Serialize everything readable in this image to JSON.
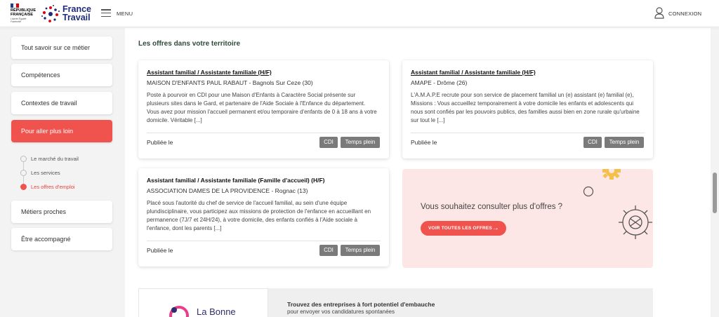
{
  "header": {
    "republic": "RÉPUBLIQUE FRANÇAISE",
    "motto": "Liberté Égalité Fraternité",
    "brand_line1": "France",
    "brand_line2": "Travail",
    "menu_label": "MENU",
    "login_label": "CONNEXION",
    "icons": [
      "marianne-logo",
      "france-travail-logo",
      "menu-icon",
      "user-icon"
    ]
  },
  "sidebar": {
    "items": [
      {
        "label": "Tout savoir sur ce métier"
      },
      {
        "label": "Compétences"
      },
      {
        "label": "Contextes de travail"
      },
      {
        "label": "Pour aller plus loin",
        "active": true
      },
      {
        "label": "Métiers proches"
      },
      {
        "label": "Être accompagné"
      }
    ],
    "subitems": [
      {
        "label": "Le marché du travail"
      },
      {
        "label": "Les services"
      },
      {
        "label": "Les offres d'emploi",
        "active": true
      }
    ]
  },
  "main": {
    "section_title": "Les offres dans votre territoire",
    "offers": [
      {
        "title": "Assistant familial / Assistante familiale (H/F)",
        "company": "MAISON D'ENFANTS PAUL RABAUT - Bagnols Sur Ceze (30)",
        "description": "Poste à pourvoir en CDI pour une Maison d'Enfants à Caractère Social présente sur plusieurs sites dans le Gard, et partenaire de l'Aide Sociale à l'Enfance du département. Vous avez pour mission l'accueil permanent et/ou temporaire d'enfants de 0 à 18 ans à votre domicile. Véritable [...]",
        "published": "Publiée le",
        "tags": [
          "CDI",
          "Temps plein"
        ]
      },
      {
        "title": "Assistant familial / Assistante familiale (H/F)",
        "company": "AMAPE - Drôme (26)",
        "description": "L'A.M.A.P.E recrute pour son service de placement familial un (e) assistant (e) familial (e), Missions : Vous accueillez temporairement à votre domicile les enfants et adolescents qui nous sont confiés par les pouvoirs publics, des familles aussi bien en zone rurale qu'urbaine sur tout le [...]",
        "published": "Publiée le",
        "tags": [
          "CDI",
          "Temps plein"
        ]
      },
      {
        "title": "Assistant familial / Assistante familiale (Famille d'accueil) (H/F)",
        "company": "ASSOCIATION DAMES DE LA PROVIDENCE - Rognac (13)",
        "description": "Placé sous l'autorité du chef de service de l'accueil familial, au sein d'une équipe plundisciplinaire, vous participez aux missions de protection de l'enfance en accueillant en permanence (7J/7 et 24H/24), à votre domicile, des enfants confiés à l'Aide sociale à l'enfance, dont les parents [...]",
        "published": "Publiée le",
        "tags": [
          "CDI",
          "Temps plein"
        ]
      }
    ],
    "promo": {
      "text": "Vous souhaitez consulter plus d'offres ?",
      "button": "VOIR TOUTES LES OFFRES",
      "arrow": "→"
    },
    "banner": {
      "logo_text": "La Bonne",
      "title": "Trouvez des entreprises à fort potentiel d'embauche",
      "subtitle": "pour envoyer vos candidatures spontanées"
    }
  },
  "colors": {
    "accent": "#f0534e",
    "brand_blue": "#1e2b7a",
    "tag_gray": "#7a7a7a",
    "promo_bg": "#fde7e6"
  }
}
